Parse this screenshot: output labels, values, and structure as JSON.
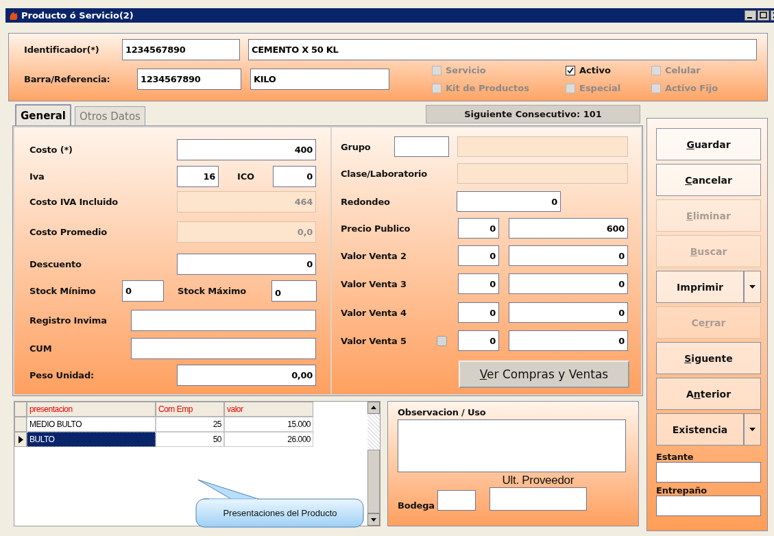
{
  "window": {
    "title": "Producto ó Servicio(2)"
  },
  "header": {
    "identificador": {
      "label": "Identificador(*)",
      "value": "1234567890",
      "description": "CEMENTO X 50 KL"
    },
    "barra": {
      "label": "Barra/Referencia:",
      "value": "1234567890",
      "unit": "KILO"
    },
    "checkboxes": [
      {
        "label": "Servicio",
        "checked": false,
        "disabled": true
      },
      {
        "label": "Activo",
        "checked": true,
        "disabled": false
      },
      {
        "label": "Celular",
        "checked": false,
        "disabled": true
      },
      {
        "label": "Kit de Productos",
        "checked": false,
        "disabled": true
      },
      {
        "label": "Especial",
        "checked": false,
        "disabled": true
      },
      {
        "label": "Activo Fijo",
        "checked": false,
        "disabled": true
      }
    ]
  },
  "tabs": [
    {
      "label": "General",
      "selected": true
    },
    {
      "label": "Otros Datos",
      "selected": false
    }
  ],
  "consecutive_button": "Siguiente Consecutivo: 101",
  "general": {
    "costo": {
      "label": "Costo (*)",
      "value": "400"
    },
    "iva": {
      "label": "Iva",
      "value": "16"
    },
    "ico": {
      "label": "ICO",
      "value": "0"
    },
    "costo_iva": {
      "label": "Costo IVA Incluido",
      "value": "464",
      "disabled": true
    },
    "costo_promedio": {
      "label": "Costo Promedio",
      "value": "0,0",
      "disabled": true
    },
    "descuento": {
      "label": "Descuento",
      "value": "0"
    },
    "stock_minimo": {
      "label": "Stock Mínimo",
      "value": "0"
    },
    "stock_maximo": {
      "label": "Stock Máximo",
      "value": "0"
    },
    "registro_invima": {
      "label": "Registro Invima"
    },
    "cum": {
      "label": "CUM"
    },
    "peso_unidad": {
      "label": "Peso Unidad:",
      "value": "0,00"
    },
    "grupo": {
      "label": "Grupo",
      "description_disabled": true
    },
    "clase": {
      "label": "Clase/Laboratorio",
      "disabled": true
    },
    "redondeo": {
      "label": "Redondeo",
      "value": "0"
    },
    "prices": [
      {
        "kind": "plain",
        "label": "Precio Publico",
        "percent": "0",
        "value": "600"
      },
      {
        "kind": "plain",
        "label": "Valor Venta 2",
        "percent": "0",
        "value": "0"
      },
      {
        "kind": "plain",
        "label": "Valor Venta 3",
        "percent": "0",
        "value": "0"
      },
      {
        "kind": "plain",
        "label": "Valor Venta 4",
        "percent": "0",
        "value": "0"
      },
      {
        "kind": "checkbox",
        "label": "Valor Venta 5",
        "checked": false,
        "percent": "0",
        "value": "0"
      }
    ],
    "ver_button": {
      "key": "V",
      "after": "er Compras y Ventas"
    }
  },
  "table": {
    "columns": [
      "presentacion",
      "Com Emp",
      "valor"
    ],
    "rows": [
      {
        "selected": false,
        "cells": [
          "MEDIO BULTO",
          "25",
          "15.000"
        ]
      },
      {
        "selected": true,
        "cells": [
          "BULTO",
          "50",
          "26.000"
        ]
      }
    ]
  },
  "tooltip": "Presentaciones del Producto",
  "observacion": {
    "label": "Observacion / Uso",
    "bodega_label": "Bodega",
    "proveedor_label": "Ult. Proveedor"
  },
  "side_buttons": [
    {
      "kind": "button",
      "label": {
        "key": "G",
        "after": "uardar"
      },
      "disabled": false
    },
    {
      "kind": "button",
      "label": {
        "key": "C",
        "after": "ancelar"
      },
      "disabled": false
    },
    {
      "kind": "button",
      "label": {
        "key": "E",
        "after": "liminar"
      },
      "disabled": true
    },
    {
      "kind": "button",
      "label": {
        "key": "B",
        "after": "uscar"
      },
      "disabled": true
    },
    {
      "kind": "split",
      "label": {
        "before": "Imprimir"
      },
      "disabled": false
    },
    {
      "kind": "button",
      "label": {
        "before": "Ce",
        "key": "r",
        "after": "rar"
      },
      "disabled": true
    },
    {
      "kind": "button",
      "label": {
        "key": "S",
        "after": "iguente"
      },
      "disabled": false
    },
    {
      "kind": "button",
      "label": {
        "before": "A",
        "key": "n",
        "after": "terior"
      },
      "disabled": false
    },
    {
      "kind": "split",
      "label": {
        "before": "Existencia"
      },
      "disabled": false
    }
  ],
  "estante": {
    "label": "Estante"
  },
  "entrepano": {
    "label": "Entrepaño"
  }
}
